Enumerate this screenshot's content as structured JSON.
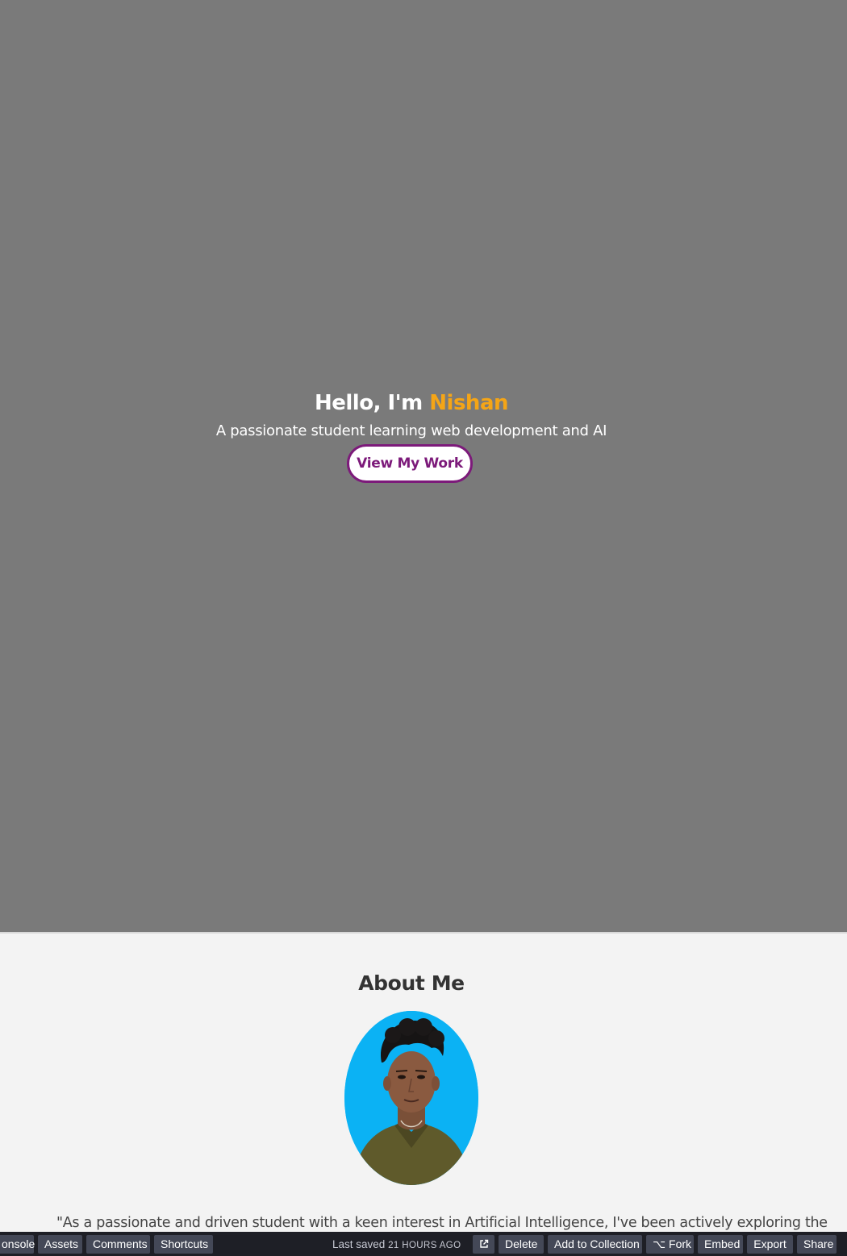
{
  "hero": {
    "greeting": "Hello, I'm",
    "name": "Nishan",
    "subtitle": "A passionate student learning web development and AI",
    "cta_label": "View My Work"
  },
  "about": {
    "title": "About Me",
    "text": "\"As a passionate and driven student with a keen interest in Artificial Intelligence, I've been actively exploring the"
  },
  "bottombar": {
    "console_label": "onsole",
    "assets_label": "Assets",
    "comments_label": "Comments",
    "shortcuts_label": "Shortcuts",
    "saved_prefix": "Last saved",
    "saved_ago": "21 HOURS AGO",
    "open_icon": "external-link-icon",
    "delete_label": "Delete",
    "collection_label": "Add to Collection",
    "fork_label": "Fork",
    "embed_label": "Embed",
    "export_label": "Export",
    "share_label": "Share"
  },
  "colors": {
    "hero_bg": "#7a7a7a",
    "accent_name": "#f5a516",
    "button_border": "#7c1a7a",
    "about_bg": "#f3f3f3",
    "bar_bg": "#1e1f26"
  }
}
